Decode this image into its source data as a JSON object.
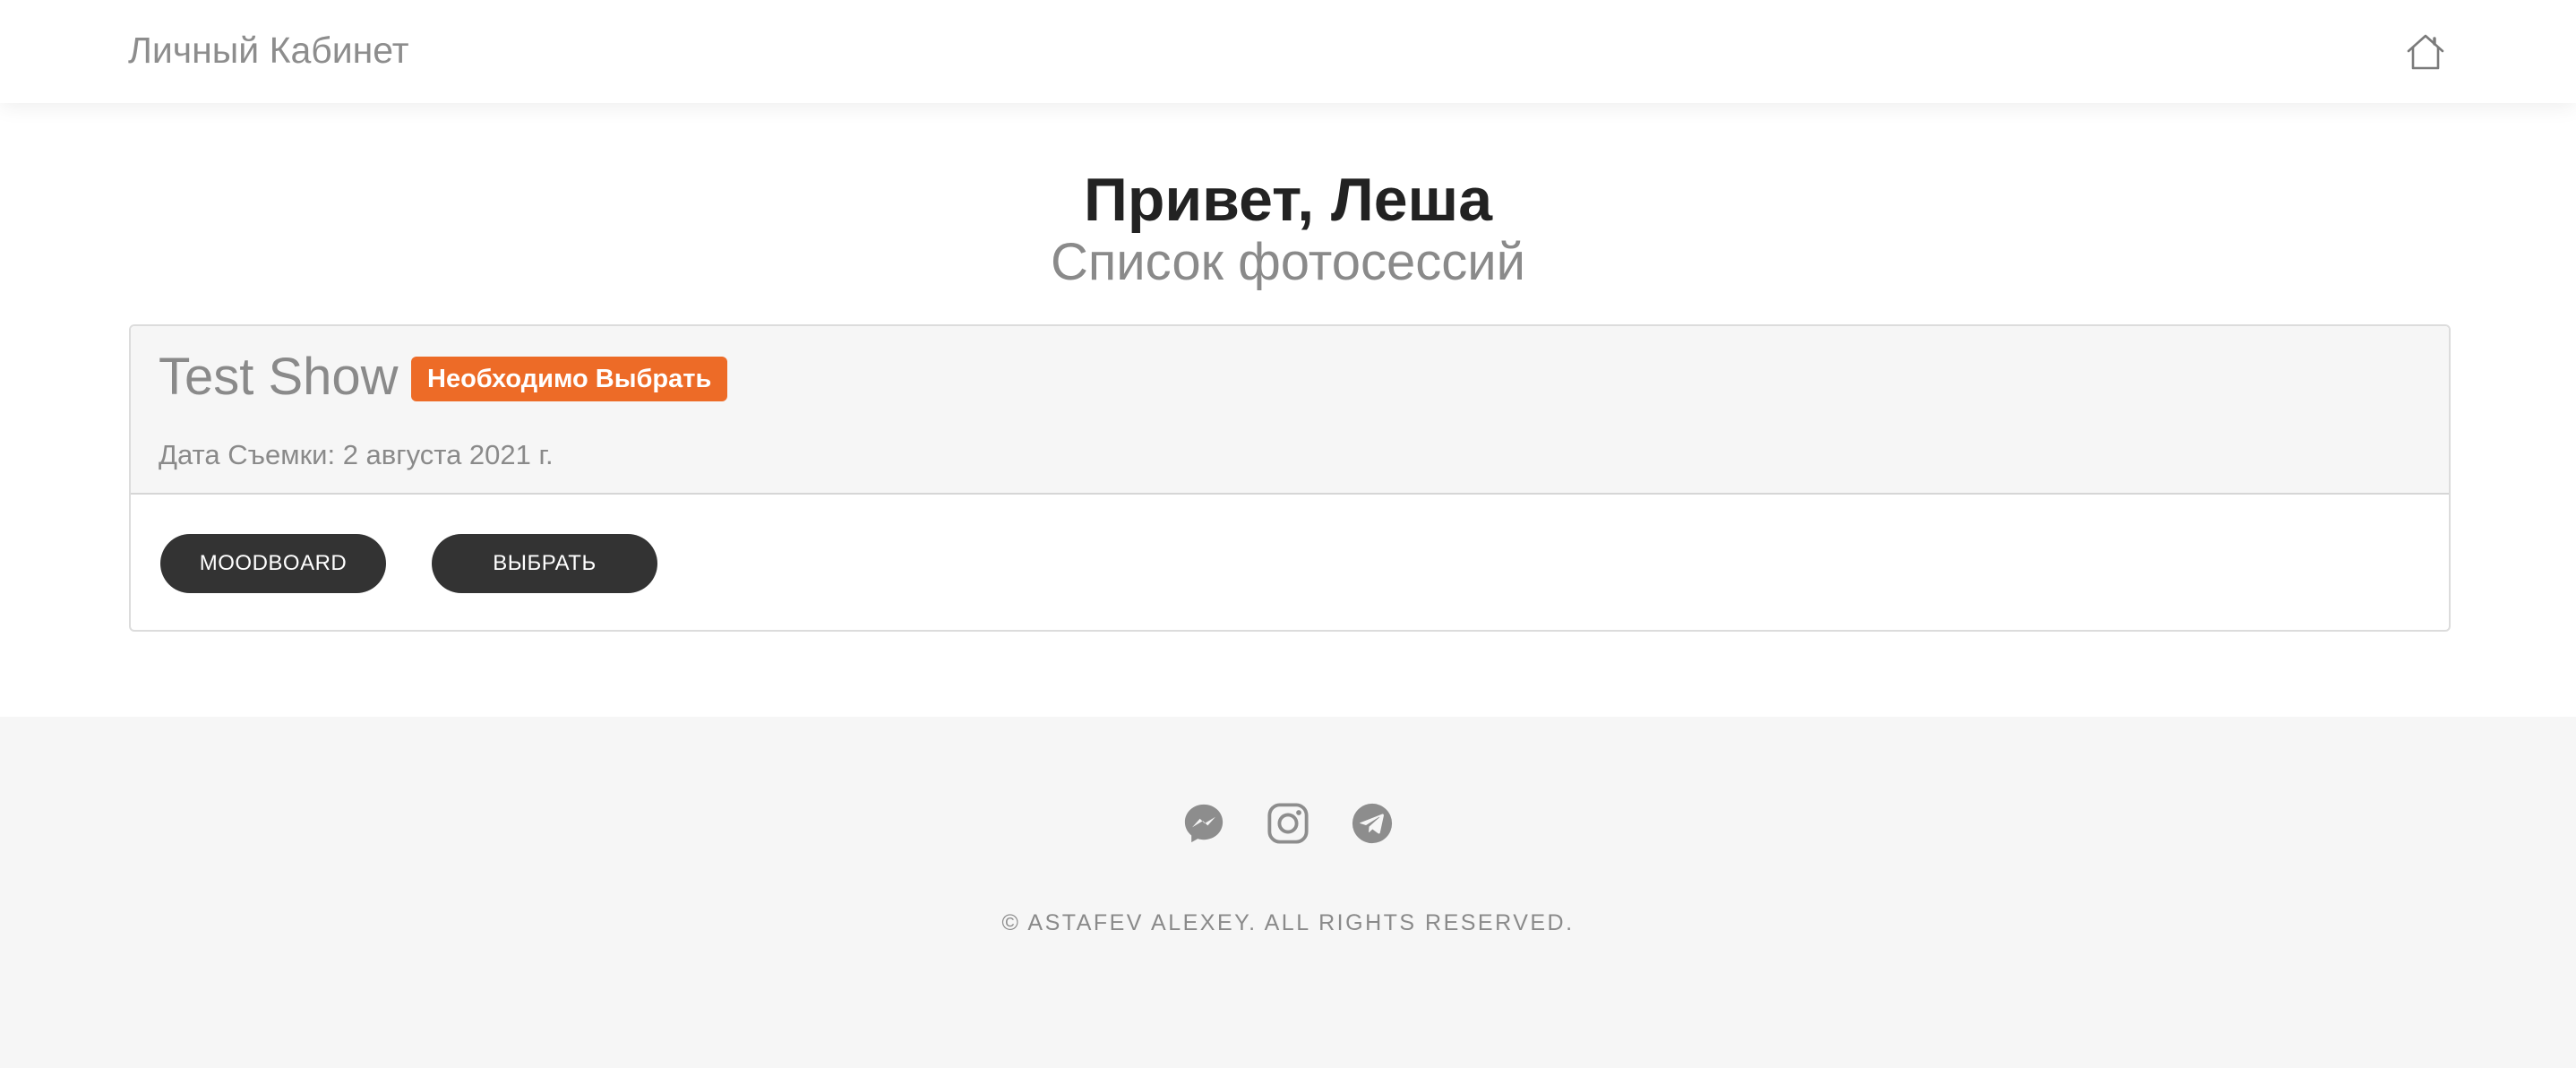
{
  "header": {
    "brand": "Личный Кабинет",
    "home_icon": "home-icon"
  },
  "greeting": {
    "title": "Привет, Леша",
    "subtitle": "Список фотосессий"
  },
  "sessions": [
    {
      "title": "Test Show",
      "status": "Необходимо Выбрать",
      "date_label": "Дата Съемки:",
      "date_value": "2 августа 2021 г.",
      "buttons": {
        "moodboard": "MOODBOARD",
        "choose": "ВЫБРАТЬ"
      }
    }
  ],
  "footer": {
    "socials": [
      "messenger-icon",
      "instagram-icon",
      "telegram-icon"
    ],
    "copyright": "© ASTAFEV ALEXEY. ALL RIGHTS RESERVED."
  },
  "colors": {
    "status_badge": "#ed6b27",
    "button_bg": "#333333",
    "footer_bg": "#f6f6f6",
    "muted_text": "#8a8a8a"
  }
}
